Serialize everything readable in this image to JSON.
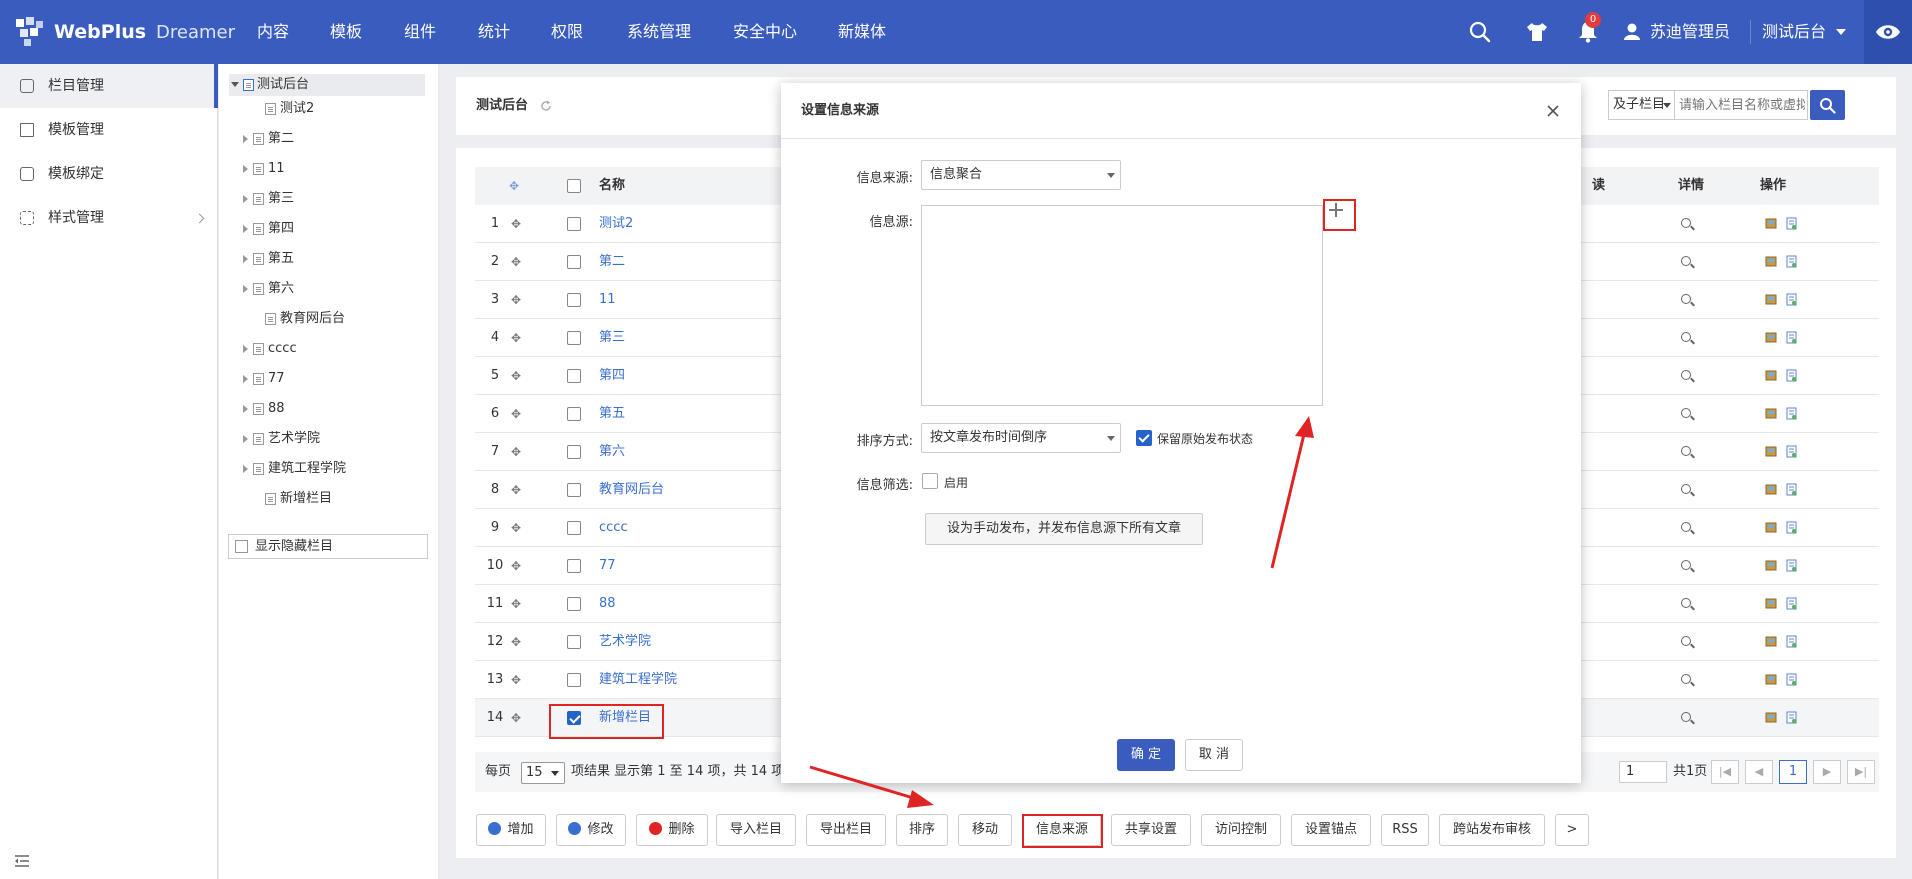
{
  "topbar": {
    "brand": "WebPlus",
    "product": "Dreamer",
    "nav": [
      "内容",
      "模板",
      "组件",
      "统计",
      "权限",
      "系统管理",
      "安全中心",
      "新媒体"
    ],
    "notification_count": "0",
    "user_name": "苏迪管理员",
    "site_name": "测试后台"
  },
  "sidebar": {
    "items": [
      {
        "label": "栏目管理",
        "icon": "columns-icon"
      },
      {
        "label": "模板管理",
        "icon": "template-icon"
      },
      {
        "label": "模板绑定",
        "icon": "bind-icon"
      },
      {
        "label": "样式管理",
        "icon": "style-icon"
      }
    ]
  },
  "tree": {
    "root": "测试后台",
    "children": [
      {
        "label": "测试2",
        "expandable": false
      },
      {
        "label": "第二",
        "expandable": true
      },
      {
        "label": "11",
        "expandable": true
      },
      {
        "label": "第三",
        "expandable": true
      },
      {
        "label": "第四",
        "expandable": true
      },
      {
        "label": "第五",
        "expandable": true
      },
      {
        "label": "第六",
        "expandable": true
      },
      {
        "label": "教育网后台",
        "expandable": false
      },
      {
        "label": "cccc",
        "expandable": true
      },
      {
        "label": "77",
        "expandable": true
      },
      {
        "label": "88",
        "expandable": true
      },
      {
        "label": "艺术学院",
        "expandable": true
      },
      {
        "label": "建筑工程学院",
        "expandable": true
      },
      {
        "label": "新增栏目",
        "expandable": false
      }
    ],
    "show_hidden_label": "显示隐藏栏目"
  },
  "main": {
    "breadcrumb": "测试后台",
    "scope_select": "及子栏目",
    "search_placeholder": "请输入栏目名称或虚拟目录",
    "table": {
      "headers": {
        "name": "名称",
        "read": "读",
        "detail": "详情",
        "actions": "操作"
      },
      "rows": [
        {
          "n": "1",
          "name": "测试2",
          "checked": false
        },
        {
          "n": "2",
          "name": "第二",
          "checked": false
        },
        {
          "n": "3",
          "name": "11",
          "checked": false
        },
        {
          "n": "4",
          "name": "第三",
          "checked": false
        },
        {
          "n": "5",
          "name": "第四",
          "checked": false
        },
        {
          "n": "6",
          "name": "第五",
          "checked": false
        },
        {
          "n": "7",
          "name": "第六",
          "checked": false
        },
        {
          "n": "8",
          "name": "教育网后台",
          "checked": false
        },
        {
          "n": "9",
          "name": "cccc",
          "checked": false
        },
        {
          "n": "10",
          "name": "77",
          "checked": false
        },
        {
          "n": "11",
          "name": "88",
          "checked": false
        },
        {
          "n": "12",
          "name": "艺术学院",
          "checked": false
        },
        {
          "n": "13",
          "name": "建筑工程学院",
          "checked": false
        },
        {
          "n": "14",
          "name": "新增栏目",
          "checked": true
        }
      ]
    },
    "pagination": {
      "per_page_label": "每页",
      "per_page_value": "15",
      "summary": "项结果 显示第 1 至 14 项，共 14 项",
      "page_input": "1",
      "total_pages": "共1页",
      "current_page": "1"
    },
    "toolbar": [
      "增加",
      "修改",
      "删除",
      "导入栏目",
      "导出栏目",
      "排序",
      "移动",
      "信息来源",
      "共享设置",
      "访问控制",
      "设置锚点",
      "RSS",
      "跨站发布审核",
      ">"
    ]
  },
  "modal": {
    "title": "设置信息来源",
    "source_label": "信息来源:",
    "source_value": "信息聚合",
    "info_source_label": "信息源:",
    "sort_label": "排序方式:",
    "sort_value": "按文章发布时间倒序",
    "keep_status_label": "保留原始发布状态",
    "keep_status_checked": true,
    "filter_label": "信息筛选:",
    "filter_enable_label": "启用",
    "manual_publish_button": "设为手动发布，并发布信息源下所有文章",
    "ok_button": "确 定",
    "cancel_button": "取 消"
  },
  "colors": {
    "primary": "#3a5cbf",
    "annotation_red": "#e02424",
    "link_blue": "#3a6fd0",
    "checkbox_blue": "#2563c9"
  }
}
